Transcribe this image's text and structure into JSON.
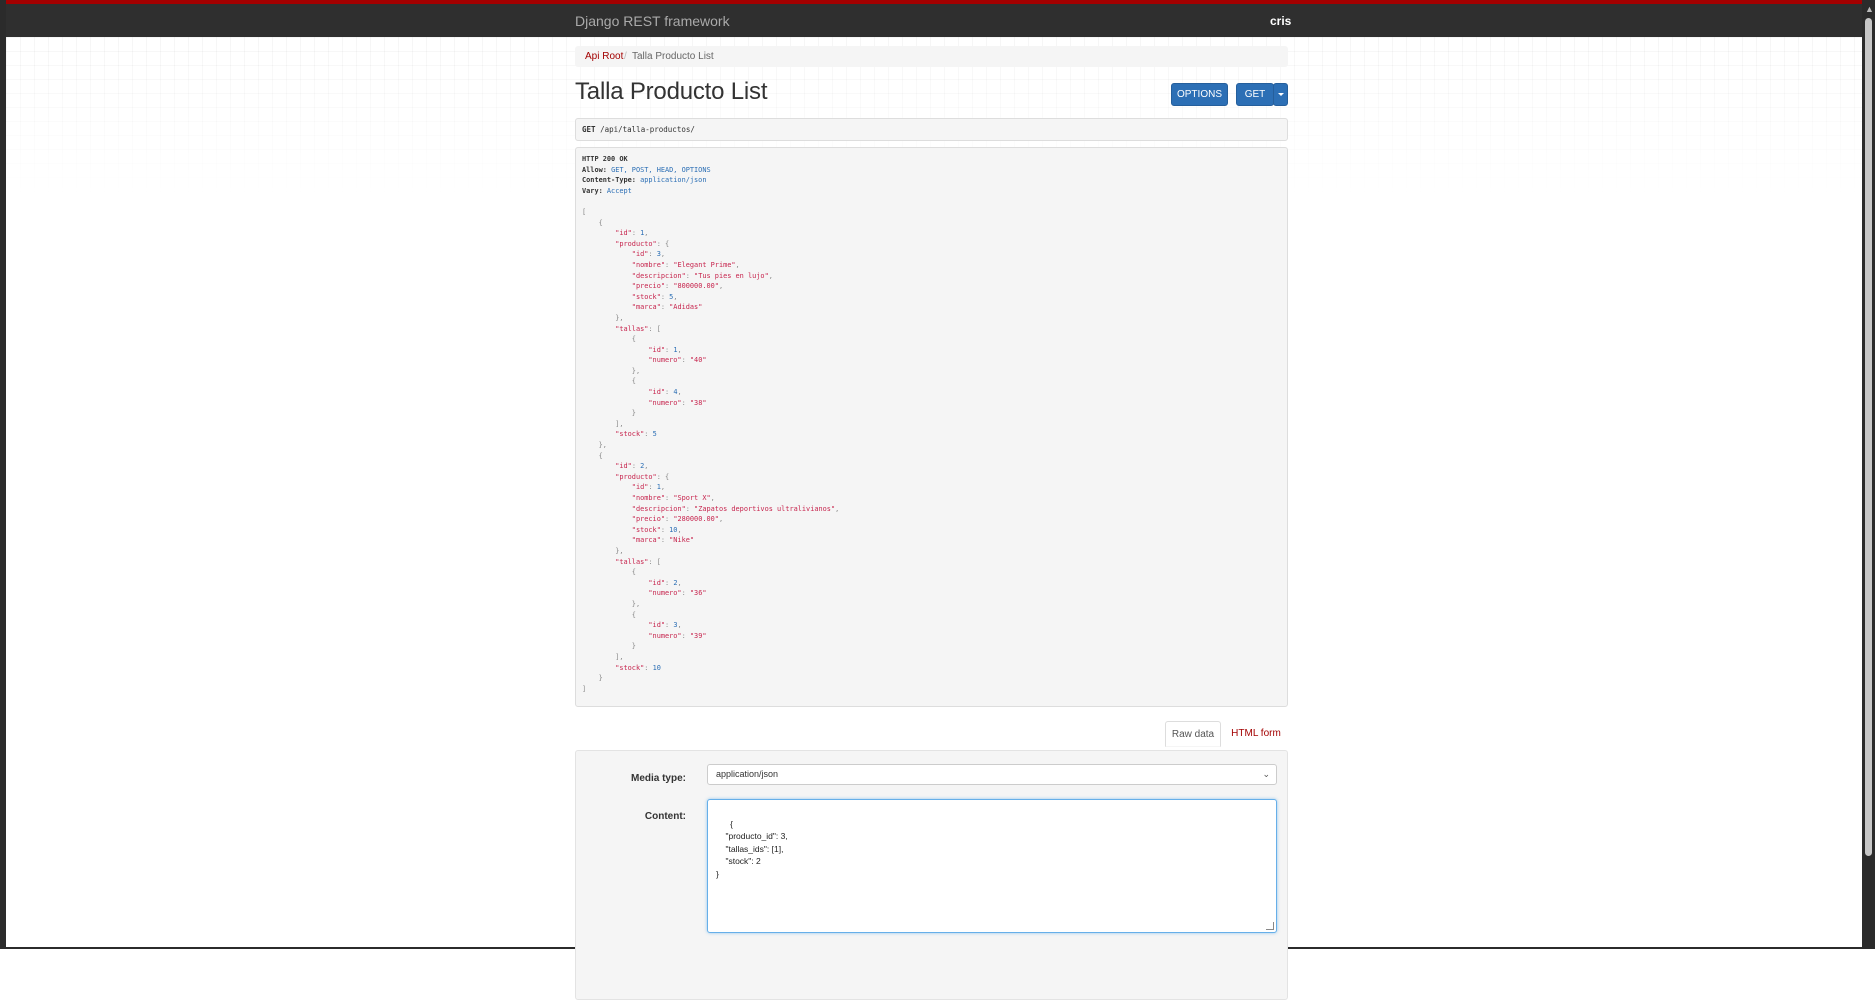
{
  "navbar": {
    "brand": "Django REST framework",
    "user": "cris"
  },
  "breadcrumb": {
    "root": "Api Root",
    "separator": "/",
    "current": "Talla Producto List"
  },
  "page": {
    "title": "Talla Producto List",
    "options_button": "OPTIONS",
    "get_button": "GET"
  },
  "request": {
    "method": "GET",
    "path": "/api/talla-productos/"
  },
  "response": {
    "status": "HTTP 200 OK",
    "headers": [
      {
        "key": "Allow:",
        "value": "GET, POST, HEAD, OPTIONS"
      },
      {
        "key": "Content-Type:",
        "value": "application/json"
      },
      {
        "key": "Vary:",
        "value": "Accept"
      }
    ],
    "body": [
      {
        "id": 1,
        "producto": {
          "id": 3,
          "nombre": "Elegant Prime",
          "descripcion": "Tus pies en lujo",
          "precio": "800000.00",
          "stock": 5,
          "marca": "Adidas"
        },
        "tallas": [
          {
            "id": 1,
            "numero": "40"
          },
          {
            "id": 4,
            "numero": "38"
          }
        ],
        "stock": 5
      },
      {
        "id": 2,
        "producto": {
          "id": 1,
          "nombre": "Sport X",
          "descripcion": "Zapatos deportivos ultralivianos",
          "precio": "280000.00",
          "stock": 10,
          "marca": "Nike"
        },
        "tallas": [
          {
            "id": 2,
            "numero": "36"
          },
          {
            "id": 3,
            "numero": "39"
          }
        ],
        "stock": 10
      }
    ]
  },
  "form": {
    "tabs": {
      "raw": "Raw data",
      "html": "HTML form"
    },
    "media_type_label": "Media type:",
    "media_type_value": "application/json",
    "content_label": "Content:",
    "content_value": "{\n    \"producto_id\": 3,\n    \"tallas_ids\": [1],\n    \"stock\": 2\n}"
  },
  "colors": {
    "accent": "#a30000",
    "primary_button": "#2c6fb5",
    "navbar": "#2f2f2f"
  }
}
